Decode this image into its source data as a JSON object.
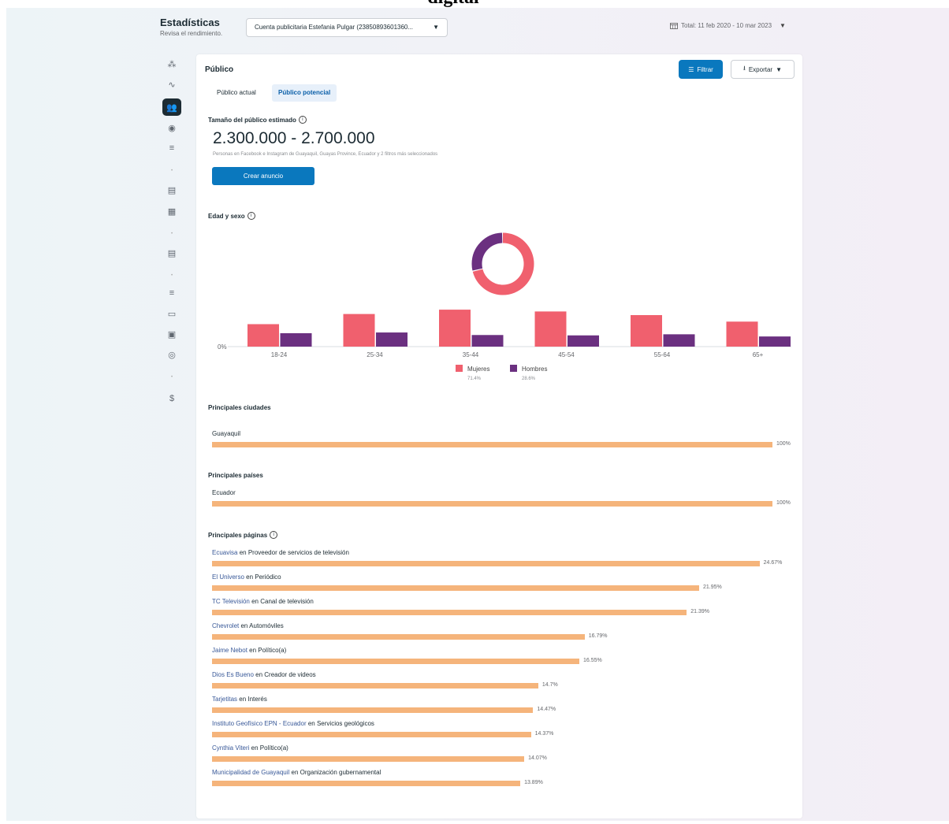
{
  "caption": "digital",
  "header": {
    "title": "Estadísticas",
    "subtitle": "Revisa el rendimiento.",
    "account": "Cuenta publicitaria Estefania Pulgar (23850893601360...",
    "date_range": "Total: 11 feb 2020 - 10 mar 2023"
  },
  "sidebar": {
    "icons": [
      "hub-icon",
      "trend-icon",
      "audience-icon",
      "comment-icon",
      "search-list-icon",
      "dot",
      "clapper-icon",
      "table-icon",
      "dot",
      "clapper-icon",
      "dot",
      "search-list-icon",
      "video-icon",
      "shield-icon",
      "search-user-icon",
      "dot",
      "dollar-icon"
    ],
    "active_index": 2
  },
  "card": {
    "title": "Público",
    "filter_label": "Filtrar",
    "export_label": "Exportar",
    "tabs": [
      "Público actual",
      "Público potencial"
    ],
    "active_tab": 1
  },
  "audience": {
    "title": "Tamaño del público estimado",
    "range": "2.300.000 - 2.700.000",
    "description": "Personas en Facebook e Instagram de Guayaquil, Guayas Province, Ecuador y 2 filtros más seleccionados",
    "create_label": "Crear anuncio"
  },
  "age_gender": {
    "title": "Edad y sexo"
  },
  "chart_data": {
    "type": "bar",
    "categories": [
      "18-24",
      "25-34",
      "35-44",
      "45-54",
      "55-64",
      "65+"
    ],
    "y_label_zero": "0%",
    "series": [
      {
        "name": "Mujeres",
        "share": "71.4%",
        "color": "#f0606e",
        "values": [
          6.2,
          9.0,
          10.2,
          9.7,
          8.7,
          6.9
        ]
      },
      {
        "name": "Hombres",
        "share": "28.6%",
        "color": "#6b3080",
        "values": [
          3.7,
          3.9,
          3.2,
          3.1,
          3.4,
          2.8
        ]
      }
    ],
    "donut": {
      "values": [
        71.4,
        28.6
      ]
    }
  },
  "cities": {
    "title": "Principales ciudades",
    "items": [
      {
        "name": "Guayaquil",
        "pct": 100,
        "label": "100%"
      }
    ]
  },
  "countries": {
    "title": "Principales países",
    "items": [
      {
        "name": "Ecuador",
        "pct": 100,
        "label": "100%"
      }
    ]
  },
  "pages": {
    "title": "Principales páginas",
    "items": [
      {
        "name": "Ecuavisa",
        "category": "en Proveedor de servicios de televisión",
        "pct": 24.67,
        "label": "24.67%"
      },
      {
        "name": "El Universo",
        "category": "en Periódico",
        "pct": 21.95,
        "label": "21.95%"
      },
      {
        "name": "TC Televisión",
        "category": "en Canal de televisión",
        "pct": 21.39,
        "label": "21.39%"
      },
      {
        "name": "Chevrolet",
        "category": "en Automóviles",
        "pct": 16.79,
        "label": "16.79%"
      },
      {
        "name": "Jaime Nebot",
        "category": "en Político(a)",
        "pct": 16.55,
        "label": "16.55%"
      },
      {
        "name": "Dios Es Bueno",
        "category": "en Creador de videos",
        "pct": 14.7,
        "label": "14.7%"
      },
      {
        "name": "Tarjetitas",
        "category": "en Interés",
        "pct": 14.47,
        "label": "14.47%"
      },
      {
        "name": "Instituto Geofísico EPN - Ecuador",
        "category": "en Servicios geológicos",
        "pct": 14.37,
        "label": "14.37%"
      },
      {
        "name": "Cynthia Viteri",
        "category": "en Político(a)",
        "pct": 14.07,
        "label": "14.07%"
      },
      {
        "name": "Municipalidad de Guayaquil",
        "category": "en Organización gubernamental",
        "pct": 13.89,
        "label": "13.89%"
      }
    ]
  }
}
